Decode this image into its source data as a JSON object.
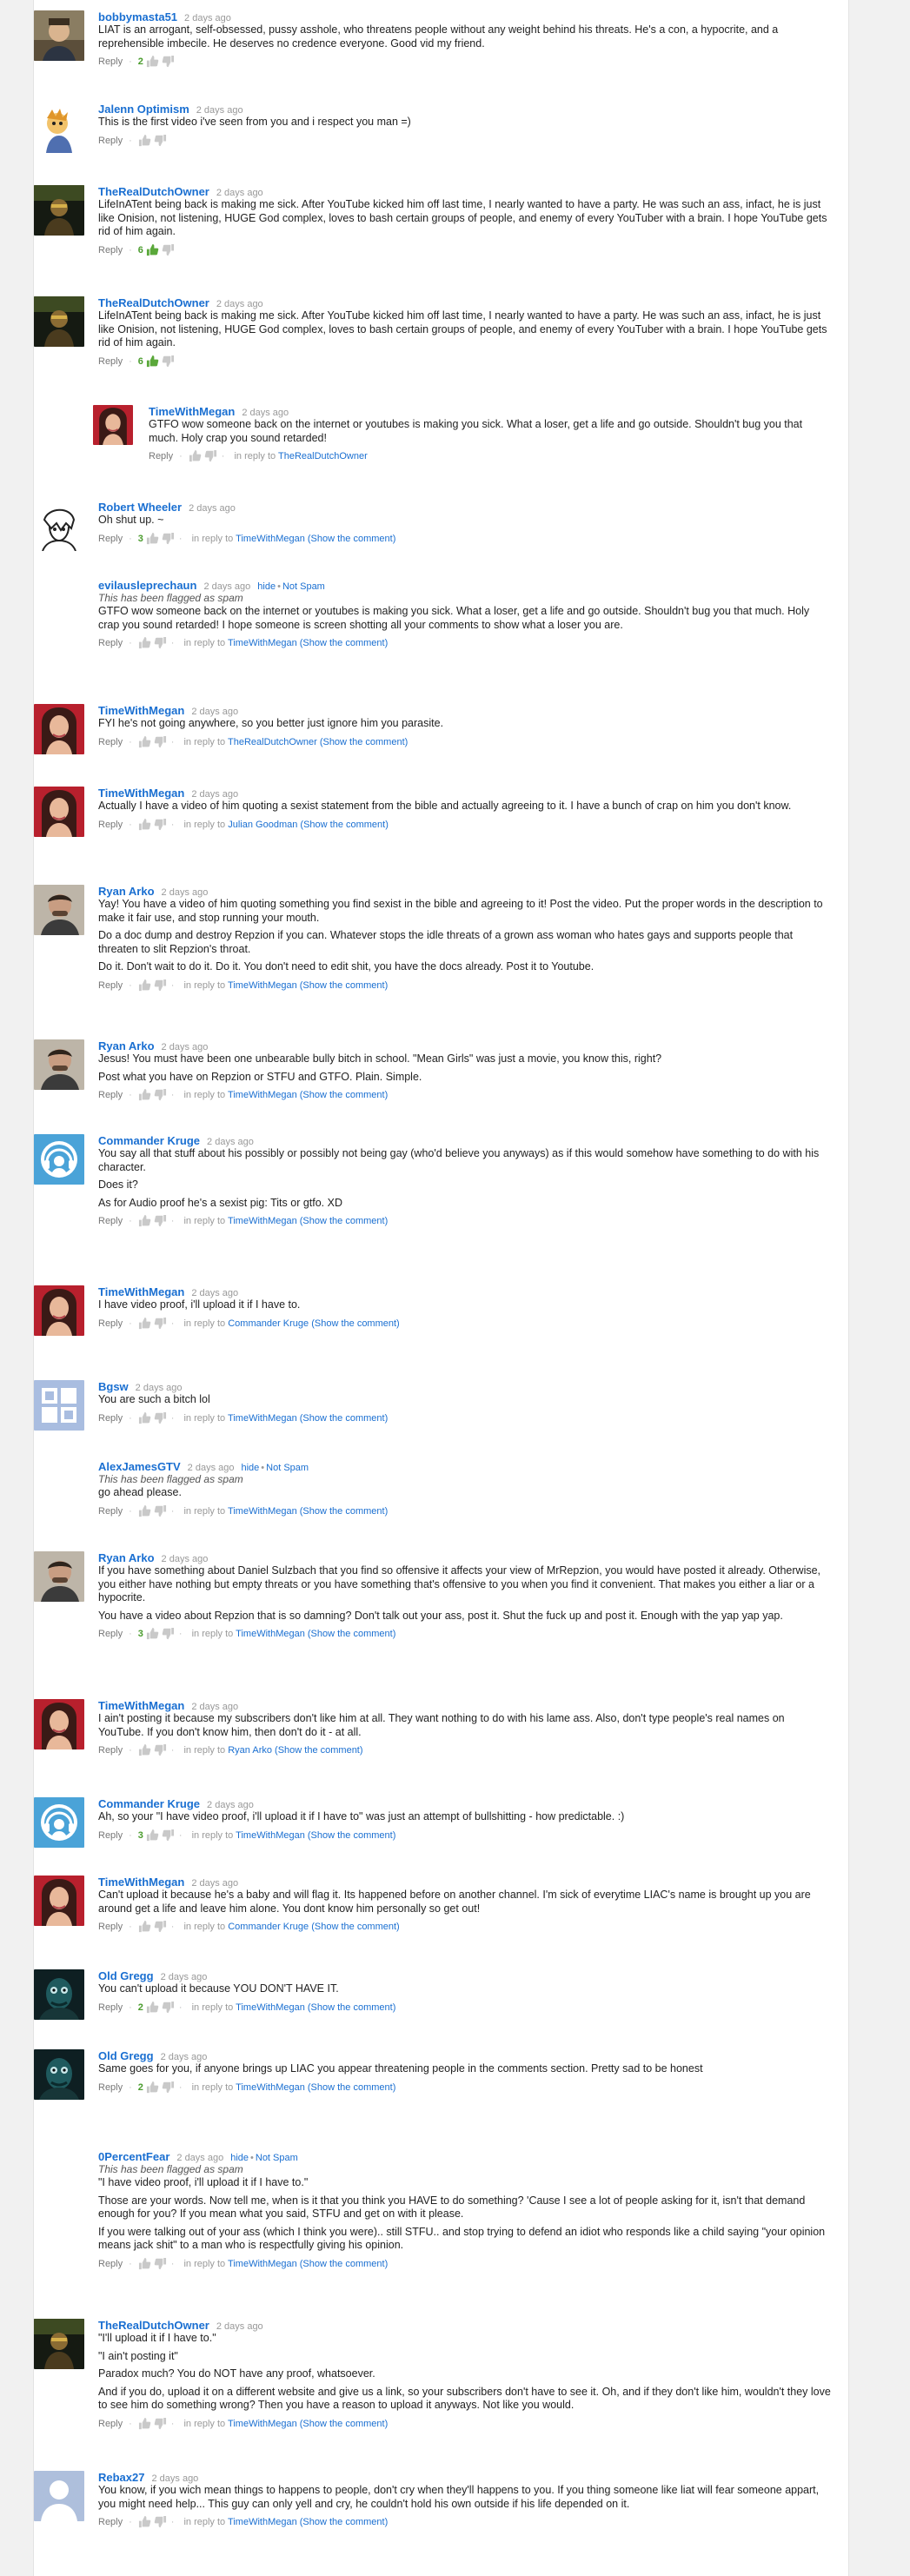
{
  "ui": {
    "reply_label": "Reply",
    "in_reply_prefix": "in reply to",
    "show_comment": "(Show the comment)",
    "flag_notice": "This has been flagged as spam",
    "flag_hide": "hide",
    "flag_notspam": "Not Spam",
    "sep": "·"
  },
  "colors": {
    "link": "#1a6fd1",
    "votes": "#4a9c2d",
    "muted": "#999999"
  },
  "comments": [
    {
      "author": "bobbymasta51",
      "time": "2 days ago",
      "avatar": "avatar-photo-man",
      "votes": "2",
      "paras": [
        "LIAT is an arrogant, self-obsessed, pussy asshole, who threatens people without any weight behind his threats. He's a con, a hypocrite, and a reprehensible imbecile. He deserves no credence everyone. Good vid my friend."
      ]
    },
    {
      "author": "Jalenn Optimism",
      "time": "2 days ago",
      "avatar": "avatar-cartoon",
      "paras": [
        "This is the first video i've seen from you and i respect you man =)"
      ]
    },
    {
      "author": "TheRealDutchOwner",
      "time": "2 days ago",
      "avatar": "avatar-dark-figure",
      "votes": "6",
      "up_active": true,
      "paras": [
        "LifeInATent being back is making me sick. After YouTube kicked him off last time, I nearly wanted to have a party. He was such an ass, infact, he is just like Onision, not listening, HUGE God complex, loves to bash certain groups of people, and enemy of every YouTuber with a brain. I hope YouTube gets rid of him again."
      ]
    },
    {
      "author": "TheRealDutchOwner",
      "time": "2 days ago",
      "avatar": "avatar-dark-figure",
      "votes": "6",
      "up_active": true,
      "paras": [
        "LifeInATent being back is making me sick. After YouTube kicked him off last time, I nearly wanted to have a party. He was such an ass, infact, he is just like Onision, not listening, HUGE God complex, loves to bash certain groups of people, and enemy of every YouTuber with a brain. I hope YouTube gets rid of him again."
      ]
    },
    {
      "author": "TimeWithMegan",
      "time": "2 days ago",
      "avatar": "avatar-woman",
      "nested": true,
      "reply_to": "TheRealDutchOwner",
      "paras": [
        "GTFO wow someone back on the internet or youtubes is making you sick. What a loser, get a life and go outside. Shouldn't bug you that much. Holy crap you sound retarded!"
      ]
    },
    {
      "author": "Robert Wheeler",
      "time": "2 days ago",
      "avatar": "avatar-sketch",
      "votes": "3",
      "reply_to": "TimeWithMegan",
      "show": true,
      "paras": [
        "Oh shut up. ~"
      ]
    },
    {
      "author": "evilausleprechaun",
      "time": "2 days ago",
      "avatar": "",
      "flagged": true,
      "reply_to": "TimeWithMegan",
      "show": true,
      "paras": [
        "GTFO wow someone back on the internet or youtubes is making you sick. What a loser, get a life and go outside. Shouldn't bug you that much. Holy crap you sound retarded! I hope someone is screen shotting all your comments to show what a loser you are."
      ]
    },
    {
      "author": "TimeWithMegan",
      "time": "2 days ago",
      "avatar": "avatar-woman",
      "reply_to": "TheRealDutchOwner",
      "show": true,
      "paras": [
        "FYI he's not going anywhere, so you better just ignore him you parasite."
      ]
    },
    {
      "author": "TimeWithMegan",
      "time": "2 days ago",
      "avatar": "avatar-woman",
      "reply_to": "Julian Goodman",
      "show": true,
      "paras": [
        "Actually I have a video of him quoting a sexist statement from the bible and actually agreeing to it. I have a bunch of crap on him you don't know."
      ]
    },
    {
      "author": "Ryan Arko",
      "time": "2 days ago",
      "avatar": "avatar-man",
      "reply_to": "TimeWithMegan",
      "show": true,
      "paras": [
        "Yay! You have a video of him quoting something you find sexist in the bible and agreeing to it! Post the video. Put the proper words in the description to make it fair use, and stop running your mouth.",
        "Do a doc dump and destroy Repzion if you can. Whatever stops the idle threats of a grown ass woman who hates gays and supports people that threaten to slit Repzion's throat.",
        "Do it. Don't wait to do it. Do it. You don't need to edit shit, you have the docs already. Post it to Youtube."
      ]
    },
    {
      "author": "Ryan Arko",
      "time": "2 days ago",
      "avatar": "avatar-man",
      "reply_to": "TimeWithMegan",
      "show": true,
      "paras": [
        "Jesus! You must have been one unbearable bully bitch in school. \"Mean Girls\" was just a movie, you know this, right?",
        "Post what you have on Repzion or STFU and GTFO. Plain. Simple."
      ]
    },
    {
      "author": "Commander Kruge",
      "time": "2 days ago",
      "avatar": "avatar-headphones",
      "reply_to": "TimeWithMegan",
      "show": true,
      "paras": [
        "You say all that stuff about his possibly or possibly not being gay (who'd believe you anyways) as if this would somehow have something to do with his character.",
        "Does it?",
        "As for Audio proof he's a sexist pig: Tits or gtfo. XD"
      ]
    },
    {
      "author": "TimeWithMegan",
      "time": "2 days ago",
      "avatar": "avatar-woman",
      "reply_to": "Commander Kruge",
      "show": true,
      "paras": [
        "I have video proof, i'll upload it if I have to."
      ]
    },
    {
      "author": "Bgsw",
      "time": "2 days ago",
      "avatar": "avatar-default-blue",
      "reply_to": "TimeWithMegan",
      "show": true,
      "paras": [
        "You are such a bitch lol"
      ]
    },
    {
      "author": "AlexJamesGTV",
      "time": "2 days ago",
      "avatar": "",
      "flagged": true,
      "reply_to": "TimeWithMegan",
      "show": true,
      "paras": [
        "go ahead please."
      ]
    },
    {
      "author": "Ryan Arko",
      "time": "2 days ago",
      "avatar": "avatar-man",
      "votes": "3",
      "reply_to": "TimeWithMegan",
      "show": true,
      "paras": [
        "If you have something about Daniel Sulzbach that you find so offensive it affects your view of MrRepzion, you would have posted it already. Otherwise, you either have nothing but empty threats or you have something that's offensive to you when you find it convenient. That makes you either a liar or a hypocrite.",
        "You have a video about Repzion that is so damning? Don't talk out your ass, post it. Shut the fuck up and post it. Enough with the yap yap yap."
      ]
    },
    {
      "author": "TimeWithMegan",
      "time": "2 days ago",
      "avatar": "avatar-woman",
      "reply_to": "Ryan Arko",
      "show": true,
      "paras": [
        "I ain't posting it because my subscribers don't like him at all. They want nothing to do with his lame ass. Also, don't type people's real names on YouTube. If you don't know him, then don't do it - at all."
      ]
    },
    {
      "author": "Commander Kruge",
      "time": "2 days ago",
      "avatar": "avatar-headphones",
      "votes": "3",
      "reply_to": "TimeWithMegan",
      "show": true,
      "paras": [
        "Ah, so your \"I have video proof, i'll upload it if I have to\" was just an attempt of bullshitting - how predictable. :)"
      ]
    },
    {
      "author": "TimeWithMegan",
      "time": "2 days ago",
      "avatar": "avatar-woman",
      "reply_to": "Commander Kruge",
      "show": true,
      "paras": [
        "Can't upload it because he's a baby and will flag it. Its happened before on another channel. I'm sick of everytime LIAC's name is brought up you are around get a life and leave him alone. You dont know him personally so get out!"
      ]
    },
    {
      "author": "Old Gregg",
      "time": "2 days ago",
      "avatar": "avatar-creature",
      "votes": "2",
      "reply_to": "TimeWithMegan",
      "show": true,
      "paras": [
        "You can't upload it because YOU DON'T HAVE IT."
      ]
    },
    {
      "author": "Old Gregg",
      "time": "2 days ago",
      "avatar": "avatar-creature",
      "votes": "2",
      "reply_to": "TimeWithMegan",
      "show": true,
      "paras": [
        "Same goes for you, if anyone brings up LIAC you appear threatening people in the comments section. Pretty sad to be honest"
      ]
    },
    {
      "author": "0PercentFear",
      "time": "2 days ago",
      "avatar": "",
      "flagged": true,
      "reply_to": "TimeWithMegan",
      "show": true,
      "paras": [
        "\"I have video proof, i'll upload it if I have to.\"",
        "Those are your words. Now tell me, when is it that you think you HAVE to do something? 'Cause I see a lot of people asking for it, isn't that demand enough for you? If you mean what you said, STFU and get on with it please.",
        "If you were talking out of your ass (which I think you were).. still STFU.. and stop trying to defend an idiot who responds like a child saying \"your opinion means jack shit\" to a man who is respectfully giving his opinion."
      ]
    },
    {
      "author": "TheRealDutchOwner",
      "time": "2 days ago",
      "avatar": "avatar-dark-figure",
      "reply_to": "TimeWithMegan",
      "show": true,
      "paras": [
        "\"I'll upload it if I have to.\"",
        "\"I ain't posting it\"",
        "Paradox much? You do NOT have any proof, whatsoever.",
        "And if you do, upload it on a different website and give us a link, so your subscribers don't have to see it. Oh, and if they don't like him, wouldn't they love to see him do something wrong? Then you have a reason to upload it anyways. Not like you would."
      ]
    },
    {
      "author": "Rebax27",
      "time": "2 days ago",
      "avatar": "avatar-default-silhouette",
      "reply_to": "TimeWithMegan",
      "show": true,
      "paras": [
        "You know, if you wich mean things to happens to people, don't cry when they'll happens to you. If you thing someone like liat will fear someone appart, you might need help... This guy can only yell and cry, he couldn't hold his own outside if his life depended on it."
      ]
    }
  ]
}
